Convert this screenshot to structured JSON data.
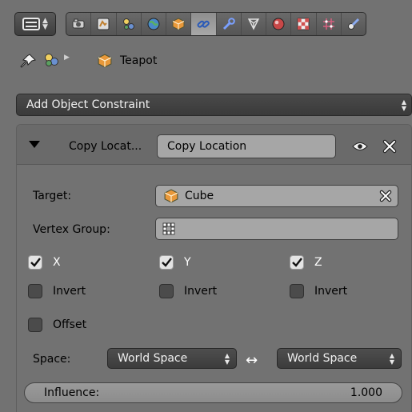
{
  "colors": {
    "background": "#727272",
    "active_tab": "#a0a0a0",
    "field": "#a6a6a6",
    "dark_button": "#404040"
  },
  "header": {
    "context_tabs": [
      {
        "icon": "render-icon",
        "color": "#c8c8c8",
        "active": false
      },
      {
        "icon": "render-layers-icon",
        "color": "#d8b060",
        "active": false
      },
      {
        "icon": "scene-icon",
        "color": "#7aa0d0",
        "active": false
      },
      {
        "icon": "world-icon",
        "color": "#5a9ad0",
        "active": false
      },
      {
        "icon": "object-icon",
        "color": "#e89a3c",
        "active": false
      },
      {
        "icon": "constraint-icon",
        "color": "#5a8ad8",
        "active": true
      },
      {
        "icon": "modifier-icon",
        "color": "#7aa0ff",
        "active": false
      },
      {
        "icon": "mesh-data-icon",
        "color": "#c8c8c8",
        "active": false
      },
      {
        "icon": "material-icon",
        "color": "#d05050",
        "active": false
      },
      {
        "icon": "texture-icon",
        "color": "#e06060",
        "active": false
      },
      {
        "icon": "particles-icon",
        "color": "#d05a7a",
        "active": false
      },
      {
        "icon": "physics-icon",
        "color": "#7a9ad8",
        "active": false
      }
    ]
  },
  "breadcrumb": {
    "object_name": "Teapot"
  },
  "add_constraint": {
    "label": "Add Object Constraint"
  },
  "constraint": {
    "short_name": "Copy Locat...",
    "name": "Copy Location",
    "target_label": "Target:",
    "target_value": "Cube",
    "vertex_group_label": "Vertex Group:",
    "vertex_group_value": "",
    "axes": [
      {
        "label": "X",
        "checked": true,
        "invert_label": "Invert",
        "invert": false
      },
      {
        "label": "Y",
        "checked": true,
        "invert_label": "Invert",
        "invert": false
      },
      {
        "label": "Z",
        "checked": true,
        "invert_label": "Invert",
        "invert": false
      }
    ],
    "offset_label": "Offset",
    "offset": false,
    "space_label": "Space:",
    "owner_space": "World Space",
    "target_space": "World Space",
    "influence_label": "Influence:",
    "influence_value": "1.000",
    "influence": 1.0
  }
}
